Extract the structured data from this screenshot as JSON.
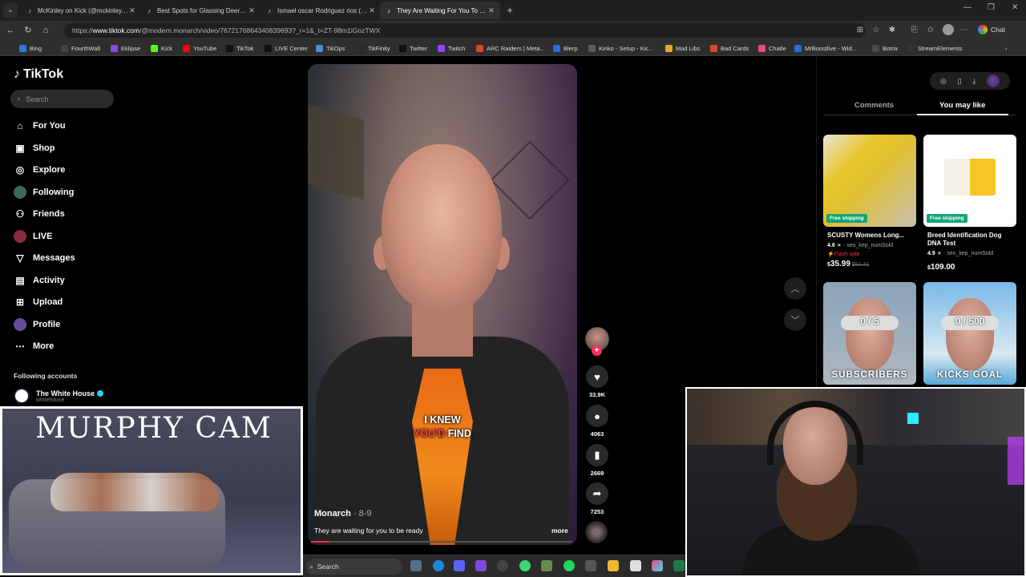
{
  "tabs": [
    {
      "title": "McKinley on Kick (@mckinley.tv) | ",
      "active": false,
      "favicon": "tiktok-icon"
    },
    {
      "title": "Best Spots for Glassing Deer: Tips",
      "active": false,
      "favicon": "tiktok-icon"
    },
    {
      "title": "Ismael oscar Rodriguez rios (@ism",
      "active": false,
      "favicon": "tiktok-icon"
    },
    {
      "title": "They Are Waiting For You To Be Re",
      "active": true,
      "favicon": "tiktok-icon"
    }
  ],
  "address": {
    "prefix": "https://",
    "domain": "www.tiktok.com",
    "path": "/@modern.monarch/video/7672176864340839693?_r=1&_t=ZT-98m1iGozTWX"
  },
  "chat_label": "Chat",
  "bookmarks": [
    "Bing",
    "FourthWall",
    "Eklipse",
    "Kick",
    "YouTube",
    "TikTok",
    "LIVE Center",
    "TikOps",
    "TikFinity",
    "Twitter",
    "Twitch",
    "ARC Raiders | Meta...",
    "Blerp",
    "Kinko - Setup - Kic...",
    "Mad Libs",
    "Bad Cards",
    "Chatle",
    "MrBoostlive - Wid...",
    "Botrix",
    "StreamElements"
  ],
  "tiktok": {
    "brand": "TikTok",
    "search_placeholder": "Search",
    "nav": [
      "For You",
      "Shop",
      "Explore",
      "Following",
      "Friends",
      "LIVE",
      "Messages",
      "Activity",
      "Upload",
      "Profile",
      "More"
    ],
    "following_accounts_label": "Following accounts",
    "following_accounts": [
      {
        "name": "The White House",
        "handle": "whitehouse"
      }
    ]
  },
  "video": {
    "caption_line1": "I KNEW",
    "caption_red": "YOU'D",
    "caption_rest": "FIND",
    "author": "Monarch",
    "date": " · 8-9",
    "description": "They are waiting for you to be ready",
    "more_label": "more",
    "progress_percent": 7,
    "likes": "33.9K",
    "comments": "4063",
    "saves": "2669",
    "shares": "7253"
  },
  "right_panel": {
    "tabs": [
      "Comments",
      "You may like"
    ],
    "active_tab": "You may like",
    "products": [
      {
        "name": "SCUSTY Womens Long...",
        "rating": "4.6",
        "sold": "seo_kep_numSold",
        "flash": "Flash sale",
        "badge": "Free shipping",
        "currency": "$",
        "price": "35.99",
        "old_price": "$51.41"
      },
      {
        "name": "Breed Identification Dog DNA Test",
        "rating": "4.9",
        "sold": "seo_kep_numSold",
        "badge": "Free shipping",
        "currency": "$",
        "price": "109.00"
      }
    ],
    "video_cards": [
      {
        "top_text": "0 / 5",
        "bottom_text": "SUBSCRIBERS"
      },
      {
        "top_text": "0 / 500",
        "bottom_text": "KICKS GOAL"
      }
    ]
  },
  "overlay": {
    "murphy_title": "MURPHY CAM"
  },
  "taskbar": {
    "search_label": "Search"
  },
  "colors": {
    "tiktok_red": "#fe2c55",
    "free_shipping": "#13a578",
    "verified": "#20d5ec"
  }
}
